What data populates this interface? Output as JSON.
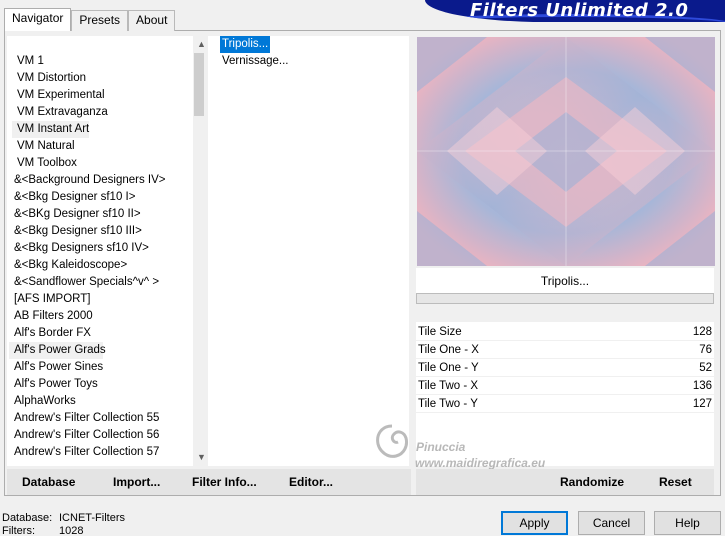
{
  "app": {
    "title": "Filters Unlimited 2.0"
  },
  "tabs": [
    {
      "label": "Navigator",
      "active": true
    },
    {
      "label": "Presets",
      "active": false
    },
    {
      "label": "About",
      "active": false
    }
  ],
  "categories": [
    "VM 1",
    "VM Distortion",
    "VM Experimental",
    "VM Extravaganza",
    "VM Instant Art",
    "VM Natural",
    "VM Toolbox",
    "&<Background Designers IV>",
    "&<Bkg Designer sf10 I>",
    "&<BKg Designer sf10 II>",
    "&<Bkg Designer sf10 III>",
    "&<Bkg Designers sf10 IV>",
    "&<Bkg Kaleidoscope>",
    "&<Sandflower Specials^v^ >",
    "[AFS IMPORT]",
    "AB Filters 2000",
    "Alf's Border FX",
    "Alf's Power Grads",
    "Alf's Power Sines",
    "Alf's Power Toys",
    "AlphaWorks",
    "Andrew's Filter Collection 55",
    "Andrew's Filter Collection 56",
    "Andrew's Filter Collection 57"
  ],
  "filters": [
    {
      "label": "Tripolis...",
      "selected": true
    },
    {
      "label": "Vernissage...",
      "selected": false
    }
  ],
  "preview": {
    "filter_name": "Tripolis...",
    "colors": {
      "pink": "#f7b7c0",
      "blue": "#9fb1d6"
    }
  },
  "params": [
    {
      "label": "Tile Size",
      "value": "128"
    },
    {
      "label": "Tile One - X",
      "value": "76"
    },
    {
      "label": "Tile One - Y",
      "value": "52"
    },
    {
      "label": "Tile Two - X",
      "value": "136"
    },
    {
      "label": "Tile Two - Y",
      "value": "127"
    }
  ],
  "left_actions": [
    {
      "label": "Database",
      "underline": "D"
    },
    {
      "label": "Import...",
      "underline": "I"
    },
    {
      "label": "Filter Info...",
      "underline": "F"
    },
    {
      "label": "Editor...",
      "underline": "E"
    }
  ],
  "right_actions": [
    {
      "label": "Randomize",
      "underline": "R"
    },
    {
      "label": "Reset",
      "underline": "R"
    }
  ],
  "status": {
    "database_label": "Database:",
    "database_value": "ICNET-Filters",
    "filters_label": "Filters:",
    "filters_value": "1028"
  },
  "buttons": {
    "apply": "Apply",
    "cancel": "Cancel",
    "help": "Help"
  },
  "watermark": {
    "line1": "Pinuccia",
    "line2": "www.maidiregrafica.eu"
  }
}
